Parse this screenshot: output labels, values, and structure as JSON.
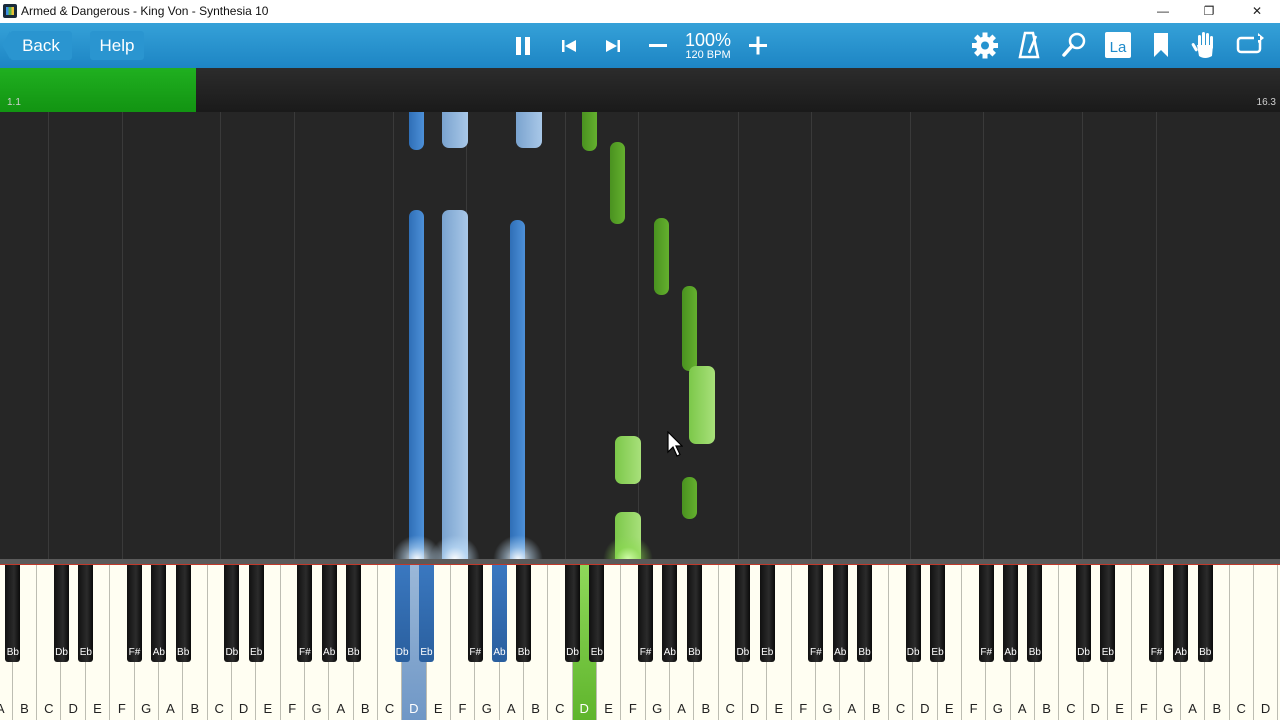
{
  "window": {
    "title": "Armed & Dangerous - King Von - Synthesia 10",
    "controls": {
      "minimize": "—",
      "restore": "❐",
      "close": "✕"
    }
  },
  "toolbar": {
    "back_label": "Back",
    "help_label": "Help",
    "speed_percent": "100%",
    "speed_bpm": "120 BPM",
    "icons": [
      "pause-icon",
      "skip-back-icon",
      "skip-forward-icon",
      "minus-icon",
      "plus-icon",
      "gear-icon",
      "metronome-icon",
      "magnifier-icon",
      "labels-icon",
      "bookmark-icon",
      "hand-icon",
      "loop-icon"
    ],
    "labels_icon_text": "La",
    "accent_color": "#1f8bcb"
  },
  "progress": {
    "fraction": 0.153,
    "start_label": "1.1",
    "end_label": "16.3",
    "fill_color": "#1aa81a"
  },
  "notes": {
    "left_hand_color": "#3d82cc",
    "right_hand_color": "#5aa82a"
  },
  "keyboard": {
    "white_keys": [
      "A",
      "B",
      "C",
      "D",
      "E",
      "F",
      "G",
      "A",
      "B",
      "C",
      "D",
      "E",
      "F",
      "G",
      "A",
      "B",
      "C",
      "D",
      "E",
      "F",
      "G",
      "A",
      "B",
      "C",
      "D",
      "E",
      "F",
      "G",
      "A",
      "B",
      "C",
      "D",
      "E",
      "F",
      "G",
      "A",
      "B",
      "C",
      "D",
      "E",
      "F",
      "G",
      "A",
      "B",
      "C",
      "D",
      "E",
      "F",
      "G",
      "A",
      "B",
      "C",
      "D",
      "E",
      "F",
      "G",
      "A",
      "B",
      "C"
    ],
    "black_keys": [
      "Bb",
      "Db",
      "Eb",
      "F#",
      "Ab",
      "Bb",
      "Db",
      "Eb",
      "F#",
      "Ab",
      "Bb",
      "Db",
      "Eb",
      "F#",
      "Ab",
      "Bb",
      "Db",
      "Eb",
      "F#",
      "Ab",
      "Bb",
      "Db",
      "Eb",
      "F#",
      "Ab",
      "Bb",
      "Db",
      "Eb",
      "F#",
      "Ab",
      "Bb",
      "Db",
      "Eb",
      "F#",
      "Ab",
      "Bb"
    ],
    "pressed_white": {
      "blue": [
        17
      ],
      "green": [
        24
      ]
    },
    "pressed_black": {
      "blue": [
        11,
        12,
        14
      ]
    }
  }
}
